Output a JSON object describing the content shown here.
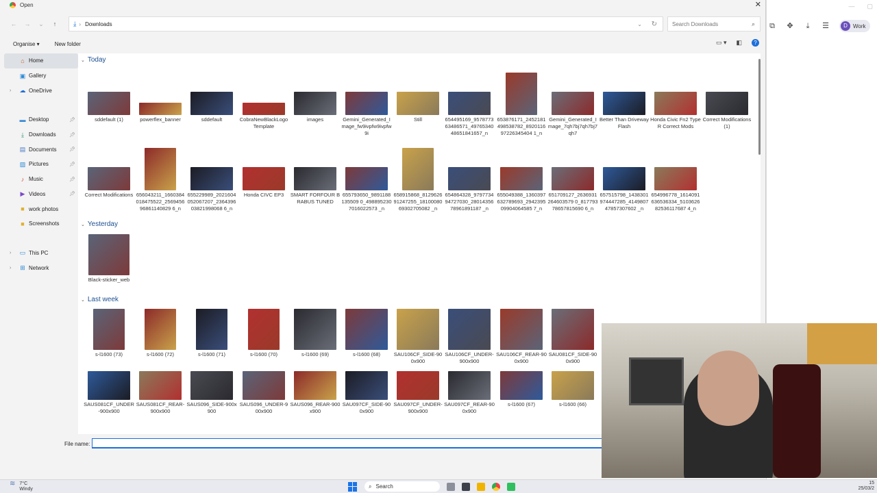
{
  "dialog": {
    "title": "Open",
    "address": {
      "location": "Downloads"
    },
    "search_placeholder": "Search Downloads",
    "commands": {
      "organise": "Organise ▾",
      "new_folder": "New folder"
    },
    "filename_label": "File name:",
    "filename_value": ""
  },
  "sidebar": {
    "items": [
      {
        "label": "Home",
        "icon": "home-icon"
      },
      {
        "label": "Gallery",
        "icon": "gallery-icon"
      },
      {
        "label": "OneDrive",
        "icon": "cloud-icon"
      },
      {
        "label": "Desktop",
        "icon": "desktop-icon"
      },
      {
        "label": "Downloads",
        "icon": "download-icon"
      },
      {
        "label": "Documents",
        "icon": "documents-icon"
      },
      {
        "label": "Pictures",
        "icon": "pictures-icon"
      },
      {
        "label": "Music",
        "icon": "music-icon"
      },
      {
        "label": "Videos",
        "icon": "videos-icon"
      },
      {
        "label": "work photos",
        "icon": "folder-icon"
      },
      {
        "label": "Screenshots",
        "icon": "folder-icon"
      },
      {
        "label": "This PC",
        "icon": "pc-icon"
      },
      {
        "label": "Network",
        "icon": "network-icon"
      }
    ]
  },
  "groups": {
    "today": "Today",
    "yesterday": "Yesterday",
    "last_week": "Last week"
  },
  "files": {
    "today": [
      "sddefault (1)",
      "powerflex_banner",
      "sddefault",
      "CobraNewBlackLogoTemplate",
      "images",
      "Gemini_Generated_Image_fw9ivpfw9ivpfw9i",
      "Still",
      "654495169_957877363486571_4976534048651841657_n",
      "653876171_2452181498538782_892011697226345404 1_n",
      "Gemini_Generated_Image_7qh7bj7qh7bj7qh7",
      "Better Than Driveway Flash",
      "Honda Civic Fn2 TypeR Correct Mods",
      "Correct Modifications (1)",
      "Correct Modifications",
      "656043211_1660384018475522_256945696861140829 6_n",
      "655229989_2021604052067207_236439603821998068 6_n",
      "Honda CIVC EP3",
      "SMART FORFOUR BRABUS TUNED",
      "655793650_9891188135509 0_4988952307016022573 _n",
      "658915868_812962691247255_1810008069302705082 _n",
      "654864328_979773494727030_2801435678961891187 _n",
      "655049388_1360397632789693_294239509904064585 7_n",
      "651709127_2636931264603579 0_81779378657815690 6_n",
      "657515798_1438301974447285_414980747857307602 _n",
      "654996778_1614091636536334_510362682536117687 4_n"
    ],
    "yesterday": [
      "Black-sticker_web"
    ],
    "last_week": [
      "s-l1600 (73)",
      "s-l1600 (72)",
      "s-l1600 (71)",
      "s-l1600 (70)",
      "s-l1600 (69)",
      "s-l1600 (68)",
      "SAU106CF_SIDE-900x900",
      "SAU106CF_UNDER-900x900",
      "SAU106CF_REAR-900x900",
      "SAU081CF_SIDE-900x900",
      "SAUS081CF_UNDER-900x900",
      "SAUS081CF_REAR-900x900",
      "SAUS096_SIDE-900x900",
      "SAUS096_UNDER-900x900",
      "SAUS096_REAR-900x900",
      "SAU097CF_SIDE-900x900",
      "SAU097CF_UNDER-900x900",
      "SAU097CF_REAR-900x900",
      "s-l1600 (67)",
      "s-l1600 (66)"
    ]
  },
  "browser": {
    "profile_initial": "D",
    "profile_label": "Work"
  },
  "taskbar": {
    "weather_temp": "7°C",
    "weather_desc": "Windy",
    "search_label": "Search",
    "time": "15",
    "date": "25/03/2"
  }
}
